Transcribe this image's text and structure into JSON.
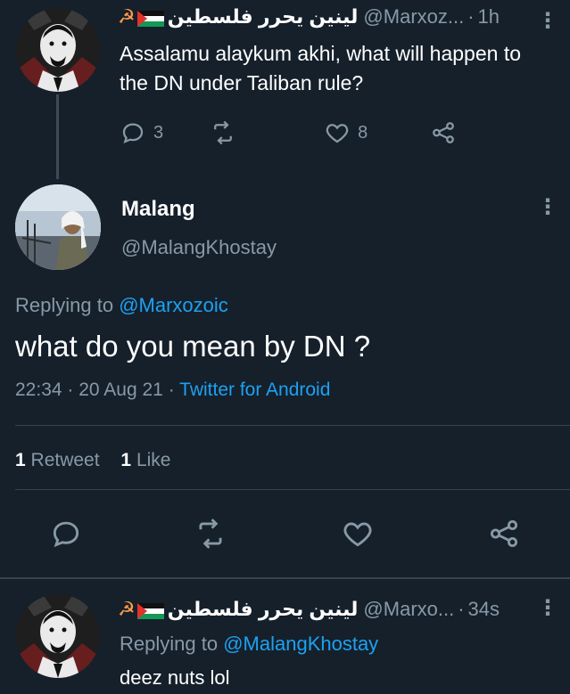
{
  "top_tweet": {
    "display_name": "لينين يحرر فلسطين",
    "emoji": "☭",
    "handle": "@Marxoz...",
    "time": "1h",
    "text": "Assalamu alaykum akhi, what will happen to the DN under Taliban rule?",
    "reply_count": "3",
    "retweet_count": "",
    "like_count": "8"
  },
  "main_tweet": {
    "display_name": "Malang",
    "handle": "@MalangKhostay",
    "replying_prefix": "Replying to",
    "replying_to": "@Marxozoic",
    "text": "what do you mean by DN ?",
    "time": "22:34",
    "date": "20 Aug 21",
    "source": "Twitter for Android",
    "retweet_num": "1",
    "retweet_label": "Retweet",
    "like_num": "1",
    "like_label": "Like"
  },
  "bottom_tweet": {
    "display_name": "لينين يحرر فلسطين",
    "emoji": "☭",
    "handle": "@Marxo...",
    "time": "34s",
    "replying_prefix": "Replying to",
    "replying_to": "@MalangKhostay",
    "text": "deez nuts lol"
  },
  "colors": {
    "background": "#15202b",
    "secondary_text": "#8899a6",
    "link": "#1da1f2",
    "divider": "#38444d"
  },
  "icons": [
    "reply-icon",
    "retweet-icon",
    "like-icon",
    "share-icon",
    "more-icon",
    "palestine-flag-icon",
    "hammer-sickle-icon"
  ]
}
